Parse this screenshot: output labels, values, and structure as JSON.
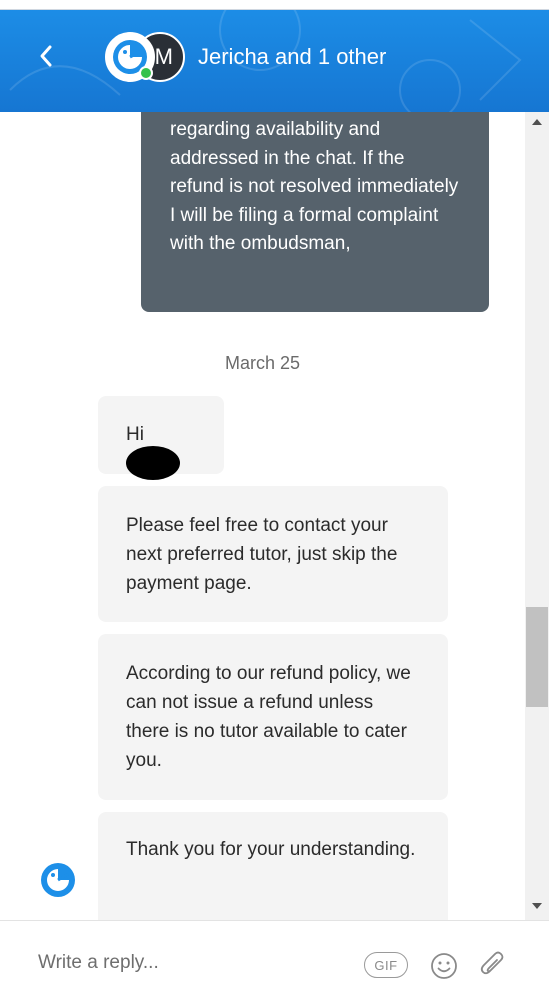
{
  "header": {
    "title": "Jericha and 1 other",
    "second_avatar_initial": "M",
    "accent_color": "#1676d2"
  },
  "conversation": {
    "outgoing_message": "regarding availability and addressed in the chat. If the refund is not resolved immediately I will be filing a formal complaint with the ombudsman,",
    "date_separator": "March 25",
    "incoming_messages": [
      {
        "text": "Hi"
      },
      {
        "text": "Please feel free to contact your next preferred tutor, just skip the payment page."
      },
      {
        "text": "According to our refund policy, we can not issue a refund unless there is no tutor available to cater you."
      },
      {
        "text": "Thank you for your understanding."
      }
    ]
  },
  "composer": {
    "placeholder": "Write a reply...",
    "gif_label": "GIF",
    "icons": [
      "emoji-icon",
      "paperclip-icon"
    ]
  }
}
